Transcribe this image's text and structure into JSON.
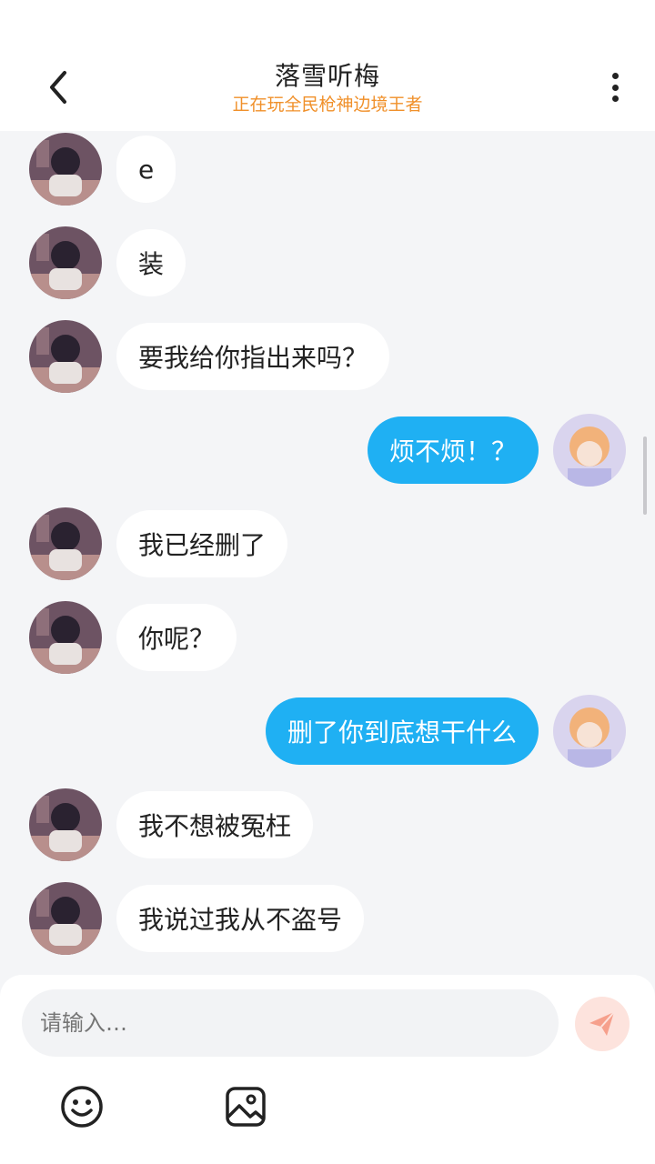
{
  "header": {
    "title": "落雪听梅",
    "subtitle": "正在玩全民枪神边境王者"
  },
  "messages": [
    {
      "side": "in",
      "text": "e"
    },
    {
      "side": "in",
      "text": "装"
    },
    {
      "side": "in",
      "text": "要我给你指出来吗？"
    },
    {
      "side": "out",
      "text": "烦不烦！？"
    },
    {
      "side": "in",
      "text": "我已经删了"
    },
    {
      "side": "in",
      "text": "你呢？"
    },
    {
      "side": "out",
      "text": "删了你到底想干什么"
    },
    {
      "side": "in",
      "text": "我不想被冤枉"
    },
    {
      "side": "in",
      "text": "我说过我从不盗号"
    }
  ],
  "composer": {
    "placeholder": "请输入…"
  },
  "icons": {
    "back": "chevron-left-icon",
    "more": "more-vertical-icon",
    "send": "send-icon",
    "emoji": "emoji-icon",
    "image": "image-icon"
  },
  "colors": {
    "outgoing_bubble": "#1fb0f3",
    "incoming_bubble": "#ffffff",
    "subtitle": "#f0902a",
    "send_button": "#fde3dd",
    "send_icon": "#f6a08c"
  }
}
